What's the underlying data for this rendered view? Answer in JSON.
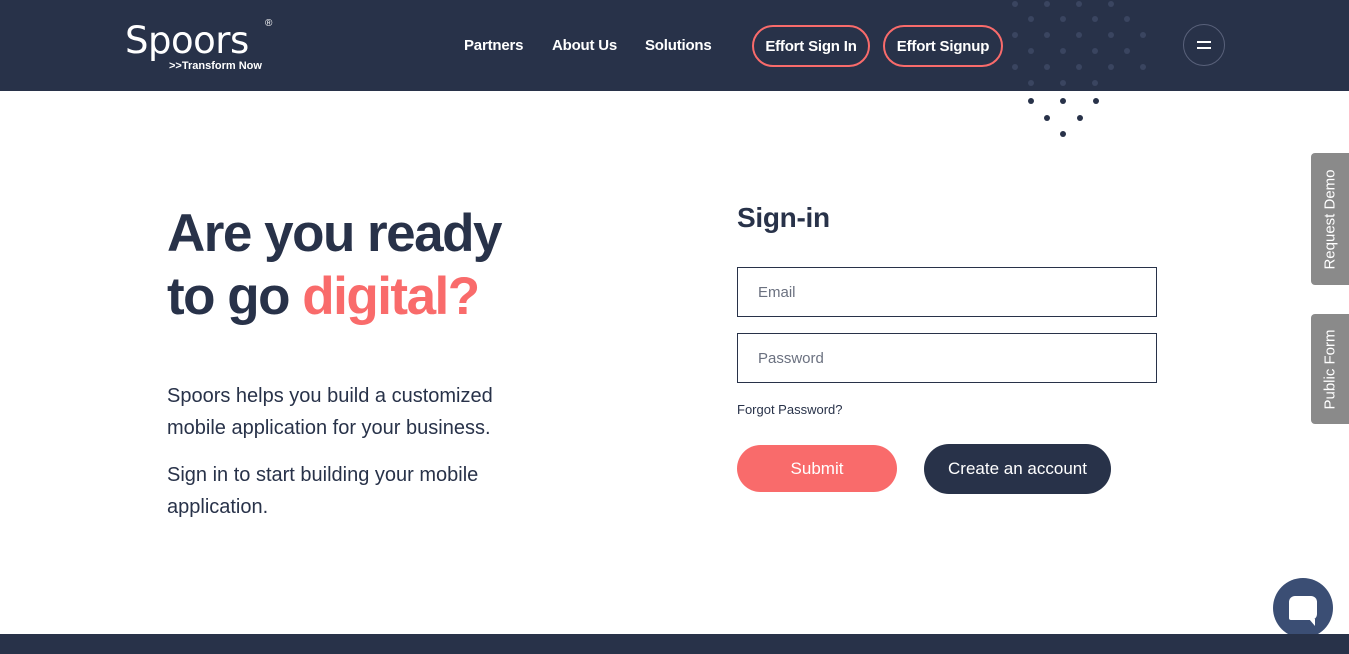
{
  "header": {
    "logo": {
      "name": "Spoors",
      "registered": "®",
      "tagline": ">>Transform Now"
    },
    "nav": [
      {
        "label": "Partners"
      },
      {
        "label": "About Us"
      },
      {
        "label": "Solutions"
      }
    ],
    "buttons": {
      "sign_in": "Effort Sign In",
      "sign_up": "Effort Signup"
    },
    "menu_icon": "hamburger-icon"
  },
  "hero": {
    "title_line1": "Are you ready",
    "title_line2_prefix": "to go ",
    "title_line2_accent": "digital?",
    "paragraph1": "Spoors helps you build a customized mobile application for your business.",
    "paragraph2": "Sign in to start building your mobile application."
  },
  "signin": {
    "title": "Sign-in",
    "email_placeholder": "Email",
    "password_placeholder": "Password",
    "forgot": "Forgot Password?",
    "submit": "Submit",
    "create_account": "Create an account"
  },
  "side_tabs": {
    "request_demo": "Request Demo",
    "public_form": "Public Form"
  },
  "chat": {
    "icon": "chat-icon"
  },
  "colors": {
    "navy": "#283249",
    "accent": "#f96b6b",
    "side_tab": "#8a8a8a",
    "chat": "#3b4e74"
  }
}
